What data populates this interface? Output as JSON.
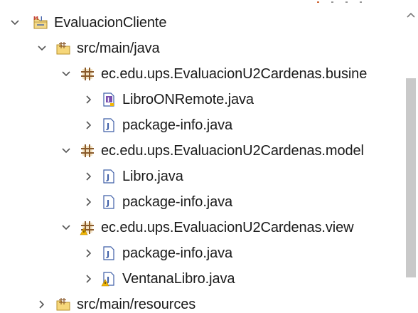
{
  "tree": {
    "project": {
      "label": "EvaluacionCliente",
      "icon": "maven-project-icon"
    },
    "src_main_java": {
      "label": "src/main/java",
      "icon": "source-folder-icon"
    },
    "pkg_business": {
      "label": "ec.edu.ups.EvaluacionU2Cardenas.busine",
      "icon": "package-icon"
    },
    "file_libro_on_remote": {
      "label": "LibroONRemote.java",
      "icon": "java-interface-icon"
    },
    "file_package_info_1": {
      "label": "package-info.java",
      "icon": "java-file-icon"
    },
    "pkg_model": {
      "label": "ec.edu.ups.EvaluacionU2Cardenas.model",
      "icon": "package-icon"
    },
    "file_libro": {
      "label": "Libro.java",
      "icon": "java-file-icon"
    },
    "file_package_info_2": {
      "label": "package-info.java",
      "icon": "java-file-icon"
    },
    "pkg_view": {
      "label": "ec.edu.ups.EvaluacionU2Cardenas.view",
      "icon": "package-warning-icon"
    },
    "file_package_info_3": {
      "label": "package-info.java",
      "icon": "java-file-icon"
    },
    "file_ventana_libro": {
      "label": "VentanaLibro.java",
      "icon": "java-file-warning-icon"
    },
    "src_main_resources": {
      "label": "src/main/resources",
      "icon": "source-folder-icon"
    }
  },
  "colors": {
    "text": "#1a1a1a",
    "chevron": "#555555",
    "package_brown": "#8a5a2b",
    "package_fill": "#f3e3c2",
    "java_blue": "#3f5fa8",
    "warning_yellow": "#f2b705",
    "scroll_thumb": "#c9c9c9"
  }
}
